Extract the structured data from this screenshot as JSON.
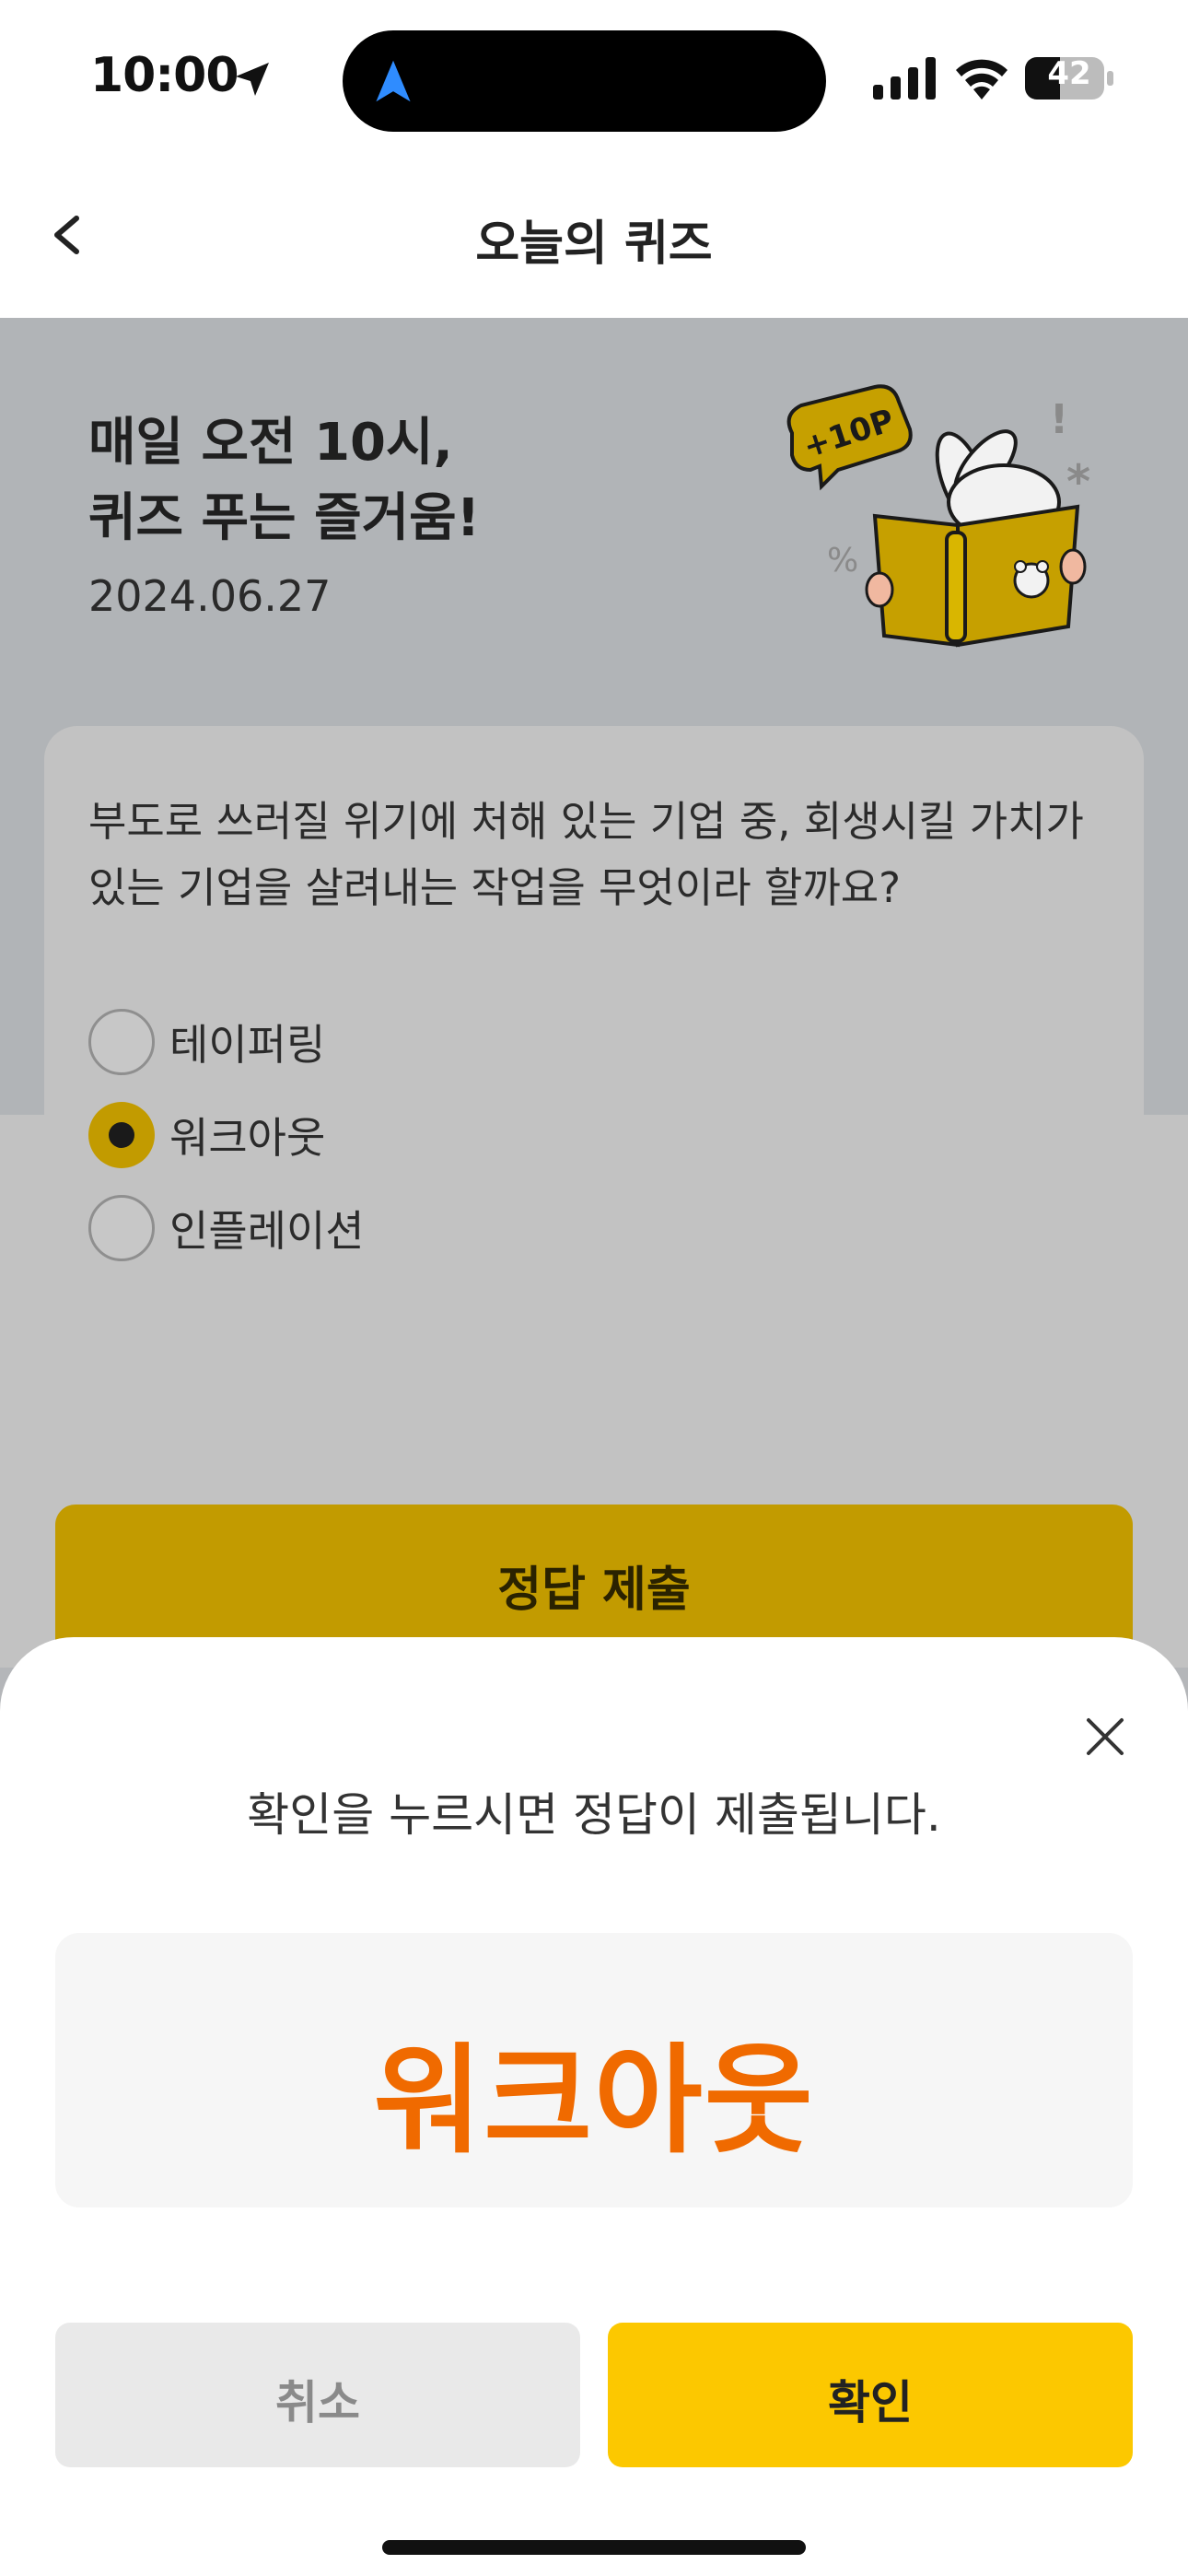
{
  "status_bar": {
    "time": "10:00",
    "battery": "42"
  },
  "header": {
    "title": "오늘의 퀴즈"
  },
  "hero": {
    "title_line1": "매일 오전 10시,",
    "title_line2": "퀴즈 푸는 즐거움!",
    "date": "2024.06.27",
    "badge": "+10P"
  },
  "quiz": {
    "question": "부도로 쓰러질 위기에 처해 있는 기업 중, 회생시킬 가치가 있는 기업을 살려내는 작업을 무엇이라 할까요?",
    "options": [
      {
        "label": "테이퍼링",
        "selected": false
      },
      {
        "label": "워크아웃",
        "selected": true
      },
      {
        "label": "인플레이션",
        "selected": false
      }
    ],
    "submit_label": "정답 제출"
  },
  "sheet": {
    "message": "확인을 누르시면 정답이 제출됩니다.",
    "answer": "워크아웃",
    "cancel_label": "취소",
    "confirm_label": "확인"
  },
  "colors": {
    "accent_yellow": "#fcc800",
    "answer_orange": "#f06a00",
    "dimmed_gold": "#c29b00"
  }
}
